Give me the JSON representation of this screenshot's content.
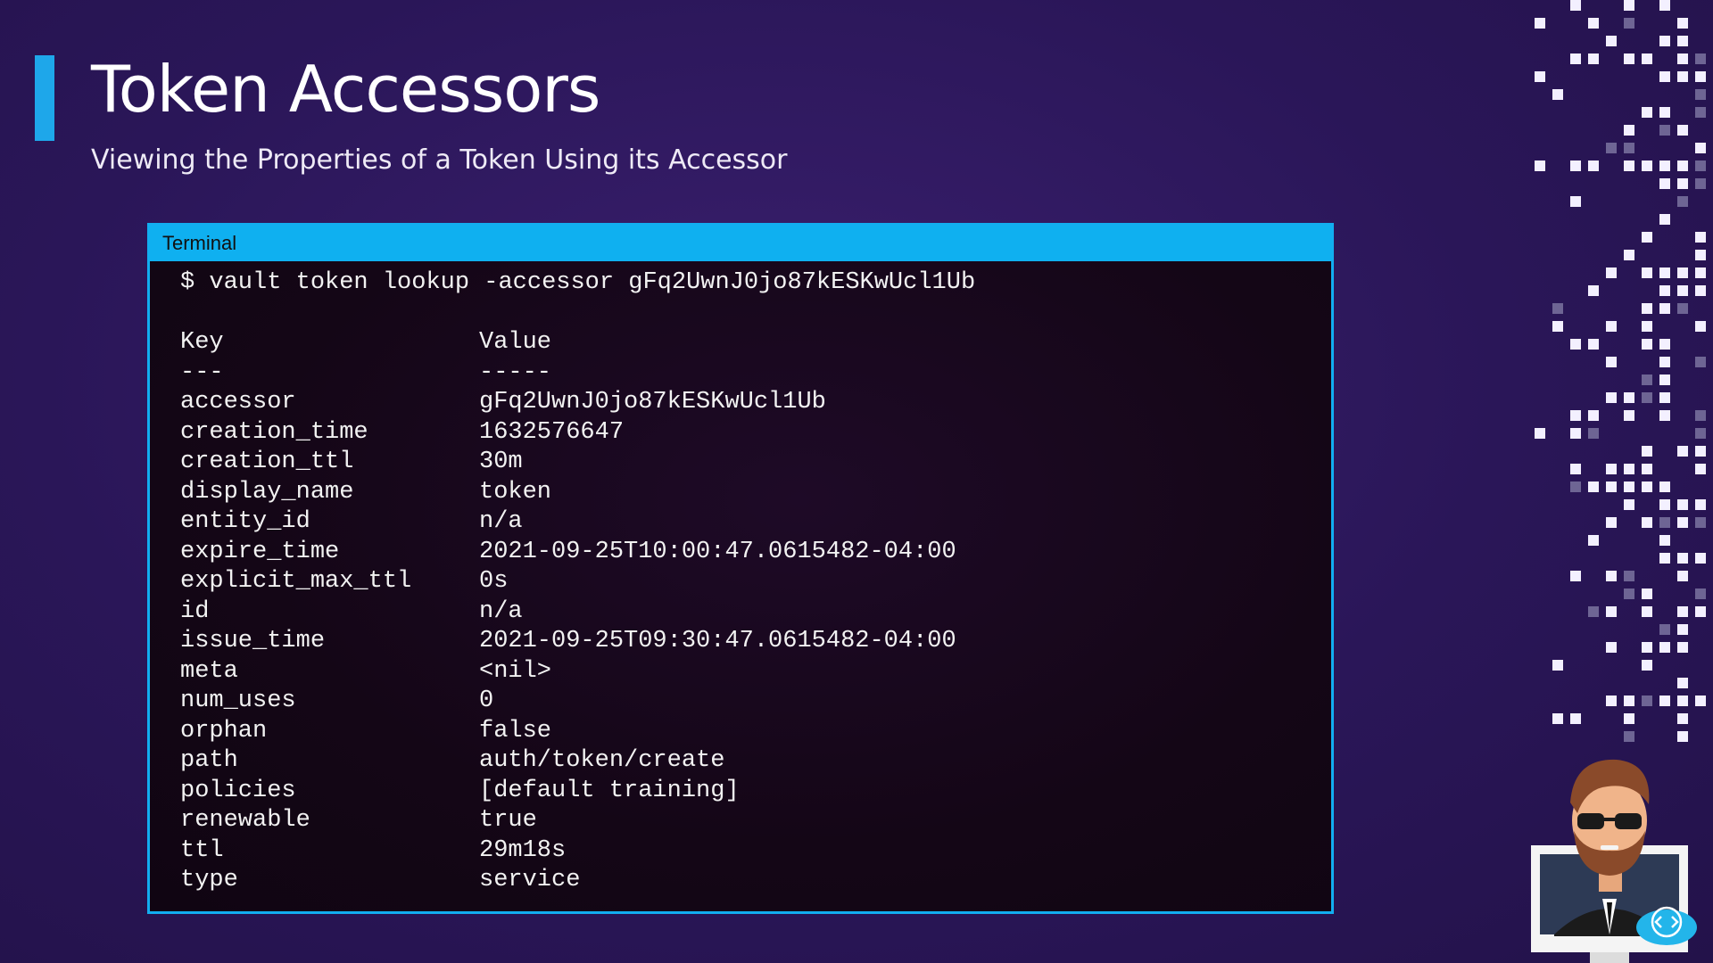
{
  "slide": {
    "title": "Token Accessors",
    "subtitle": "Viewing the Properties of a Token Using its Accessor"
  },
  "terminal": {
    "window_title": "Terminal",
    "command": "$ vault token lookup -accessor gFq2UwnJ0jo87kESKwUcl1Ub",
    "header": {
      "key": "Key",
      "value": "Value"
    },
    "separator": {
      "key": "---",
      "value": "-----"
    },
    "rows": [
      {
        "key": "accessor",
        "value": "gFq2UwnJ0jo87kESKwUcl1Ub"
      },
      {
        "key": "creation_time",
        "value": "1632576647"
      },
      {
        "key": "creation_ttl",
        "value": "30m"
      },
      {
        "key": "display_name",
        "value": "token"
      },
      {
        "key": "entity_id",
        "value": "n/a"
      },
      {
        "key": "expire_time",
        "value": "2021-09-25T10:00:47.0615482-04:00"
      },
      {
        "key": "explicit_max_ttl",
        "value": "0s"
      },
      {
        "key": "id",
        "value": "n/a"
      },
      {
        "key": "issue_time",
        "value": "2021-09-25T09:30:47.0615482-04:00"
      },
      {
        "key": "meta",
        "value": "<nil>"
      },
      {
        "key": "num_uses",
        "value": "0"
      },
      {
        "key": "orphan",
        "value": "false"
      },
      {
        "key": "path",
        "value": "auth/token/create"
      },
      {
        "key": "policies",
        "value": "[default training]"
      },
      {
        "key": "renewable",
        "value": "true"
      },
      {
        "key": "ttl",
        "value": "29m18s"
      },
      {
        "key": "type",
        "value": "service"
      }
    ]
  },
  "decorations": {
    "pixel_pattern_icon": "pixel-pattern-decoration",
    "presenter_avatar_icon": "presenter-avatar-illustration",
    "code_cloud_icon": "code-cloud-icon"
  },
  "colors": {
    "background": "#2a1658",
    "accent": "#1ea7ea",
    "terminal_bar": "#0fb0f0",
    "terminal_bg": "#140616"
  }
}
